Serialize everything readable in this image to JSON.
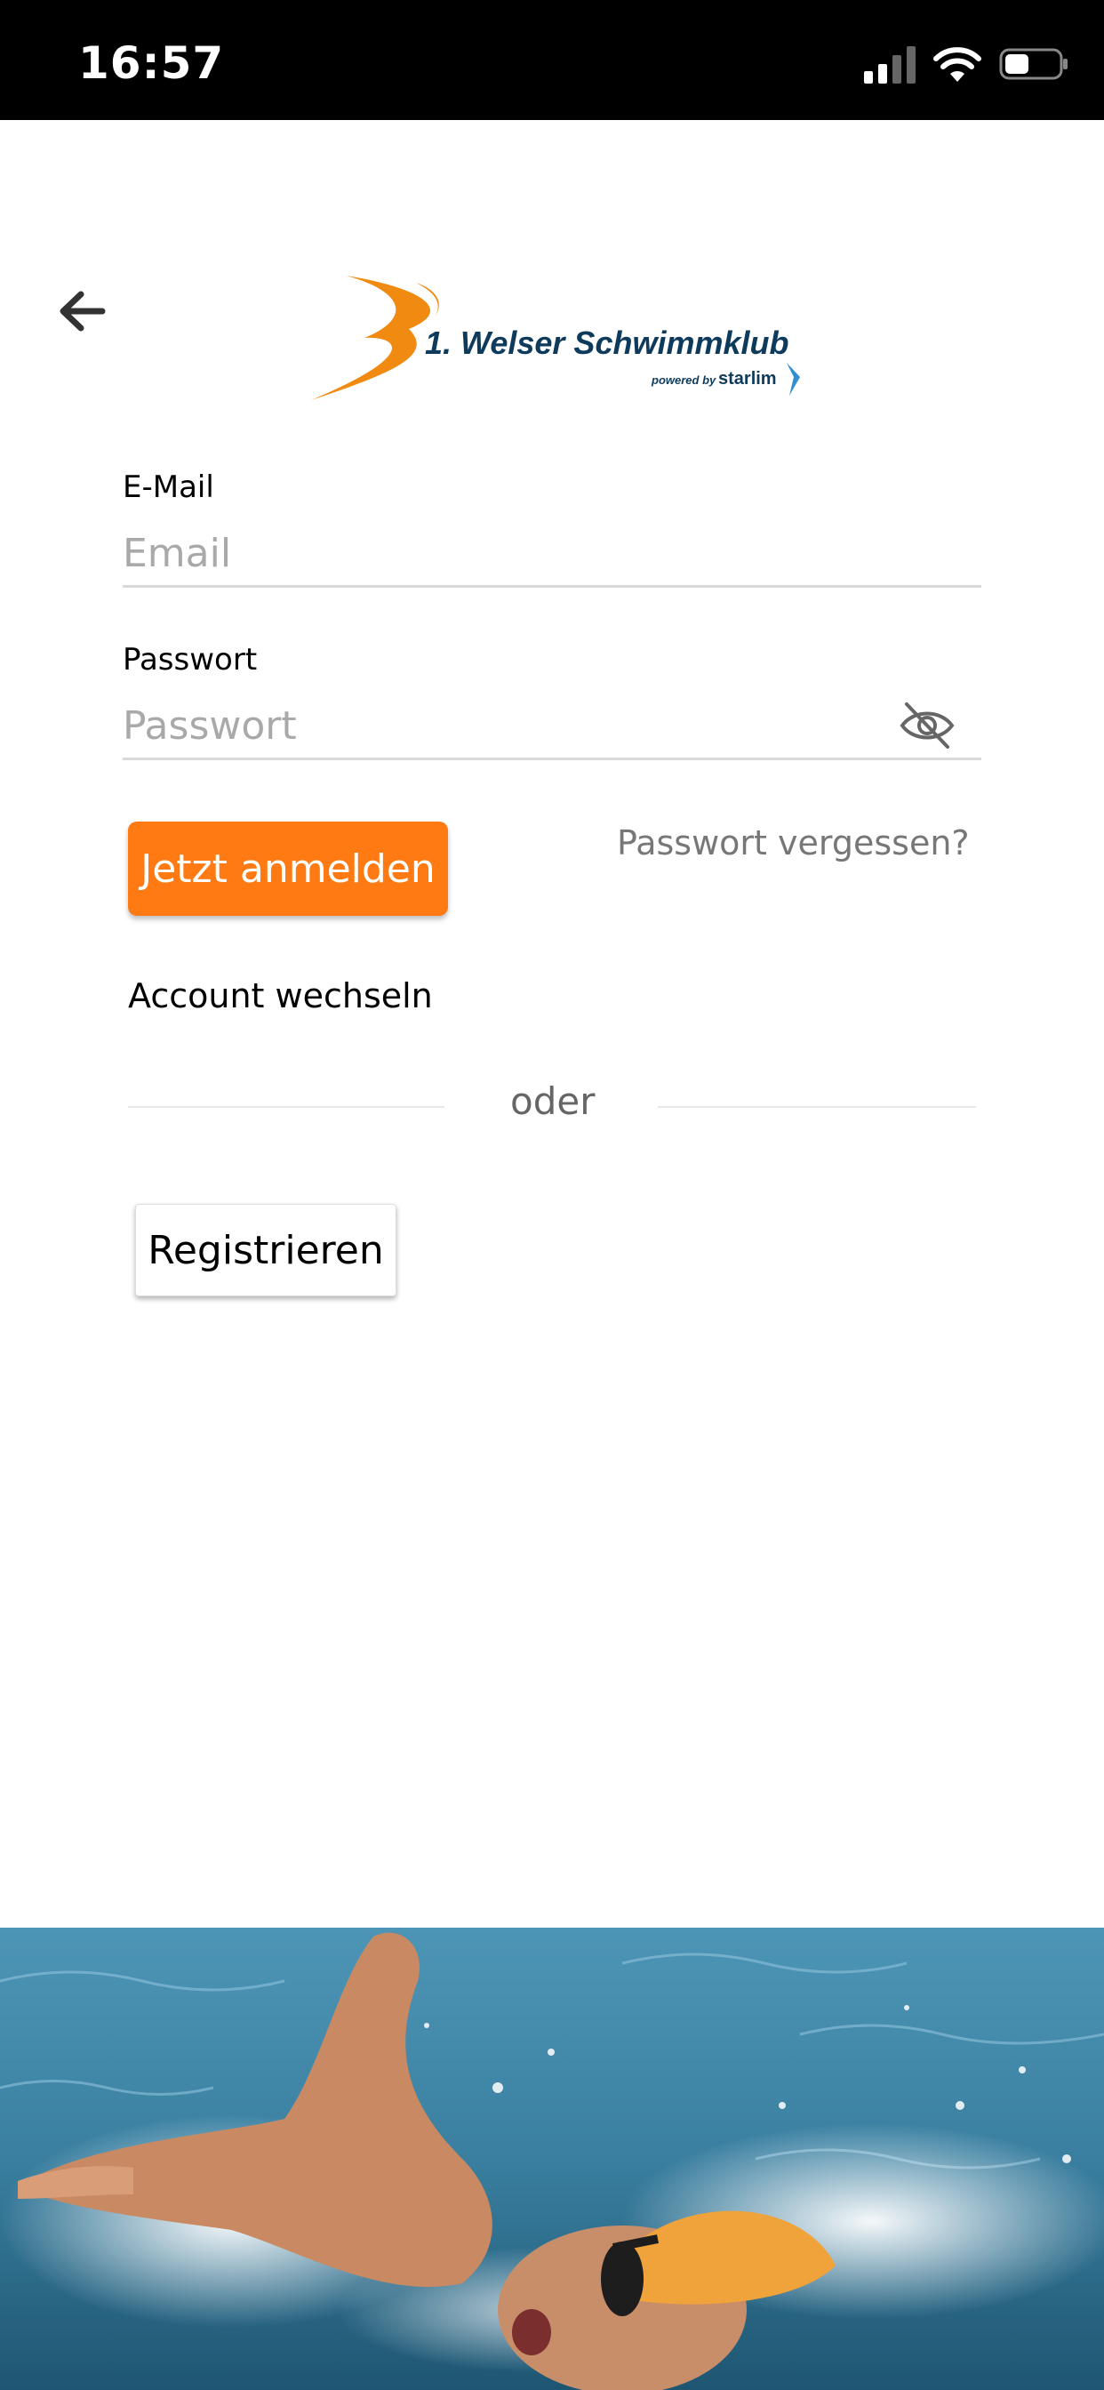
{
  "status_bar": {
    "time": "16:57",
    "icons": [
      "signal-icon",
      "wifi-icon",
      "battery-icon"
    ]
  },
  "header": {
    "back_icon": "arrow-left-icon",
    "logo_text": "1. Welser Schwimmklub",
    "logo_powered_prefix": "powered by",
    "logo_powered_brand": "starlim"
  },
  "form": {
    "email_label": "E-Mail",
    "email_placeholder": "Email",
    "email_value": "",
    "password_label": "Passwort",
    "password_placeholder": "Passwort",
    "password_value": "",
    "password_toggle_icon": "eye-slash-icon"
  },
  "actions": {
    "login_label": "Jetzt anmelden",
    "forgot_label": "Passwort vergessen?",
    "switch_account_label": "Account wechseln",
    "divider_label": "oder",
    "register_label": "Registrieren"
  },
  "colors": {
    "accent": "#ff7a12",
    "logo_navy": "#0e3a5c",
    "logo_orange": "#f08a10"
  }
}
